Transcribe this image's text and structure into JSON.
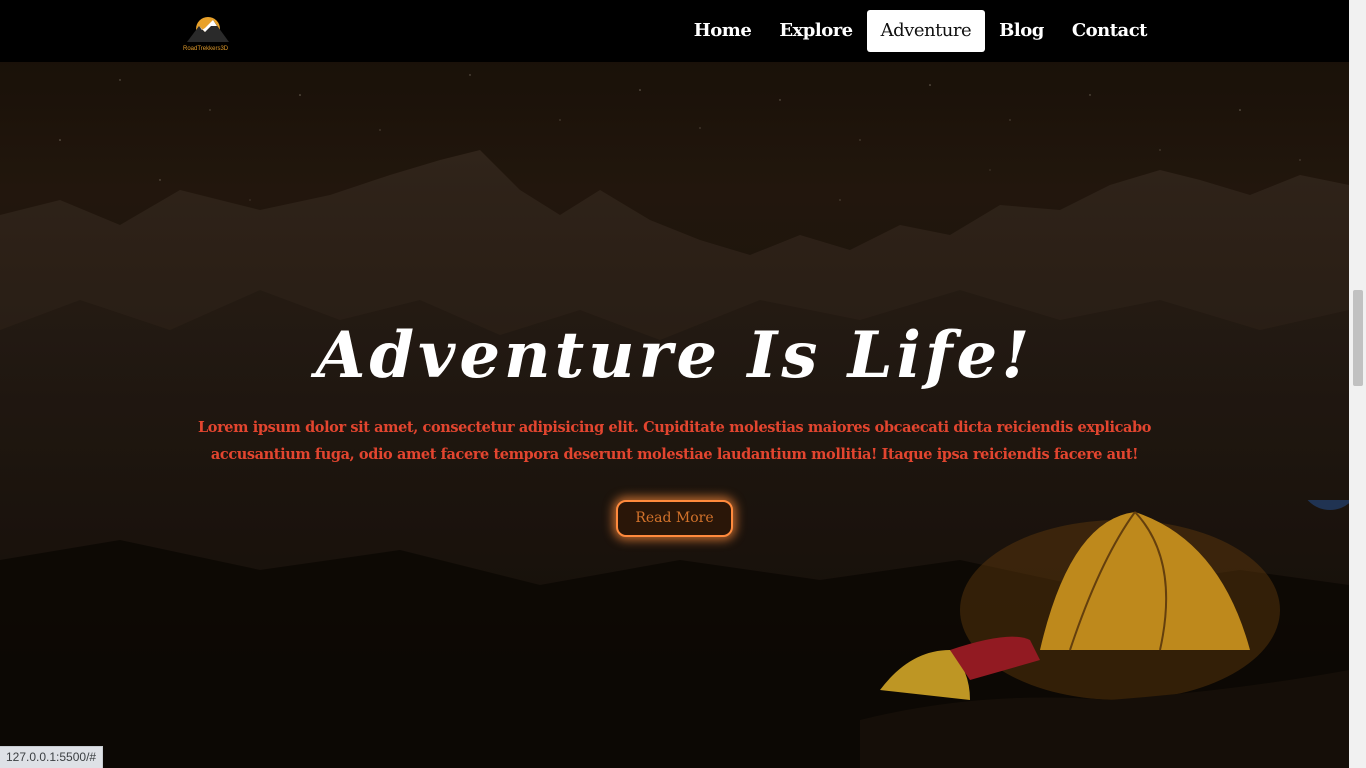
{
  "logo": {
    "alt": "Road Trekkers logo",
    "text": "RoadTrekkers3D"
  },
  "nav": {
    "items": [
      {
        "label": "Home",
        "active": false
      },
      {
        "label": "Explore",
        "active": false
      },
      {
        "label": "Adventure",
        "active": true
      },
      {
        "label": "Blog",
        "active": false
      },
      {
        "label": "Contact",
        "active": false
      }
    ]
  },
  "hero": {
    "title": "Adventure Is Life!",
    "text": "Lorem ipsum dolor sit amet, consectetur adipisicing elit. Cupiditate molestias maiores obcaecati dicta reiciendis explicabo accusantium fuga, odio amet facere tempora deserunt molestiae laudantium mollitia! Itaque ipsa reiciendis facere aut!",
    "button_label": "Read More"
  },
  "status_bar": {
    "url": "127.0.0.1:5500/#"
  },
  "colors": {
    "nav_bg": "#000000",
    "title": "#ffffff",
    "body_text": "#e2452f",
    "button_border": "#ff8a3d",
    "button_text": "#d2722b"
  }
}
